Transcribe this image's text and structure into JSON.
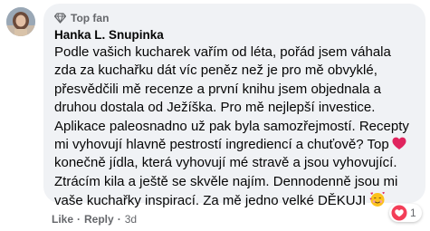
{
  "comment": {
    "badge_icon": "diamond-icon",
    "badge_label": "Top fan",
    "author": "Hanka L. Snupinka",
    "lines": [
      "Podle vašich kucharek vařím od léta, pořád jsem váhala",
      "zda za kuchařku dát víc peněz než je pro mě obvyklé,",
      "přesvědčili mě recenze a první knihu jsem objednala a",
      "druhou dostala od Ježíška. Pro mě nejlepší investice.",
      "Aplikace paleosnadno už pak byla samozřejmostí. Recepty",
      "mi vyhovují hlavně pestrostí ingrediencí a chuťově? Top",
      "konečně jídla, která vyhovují mé stravě a jsou vyhovující.",
      "Ztrácím kila a ještě se skvěle najím. Dennodenně jsou mi",
      "vaše kuchařky inspirací. Za mě jedno velké DĚKUJI"
    ],
    "emojis": [
      "red-heart-icon",
      "smiling-face-with-hearts-icon"
    ]
  },
  "actions": {
    "like_label": "Like",
    "separator": "·",
    "reply_label": "Reply",
    "time": "3d"
  },
  "reaction": {
    "icon": "love-reaction-icon",
    "count": "1"
  },
  "colors": {
    "bubble": "#f0f2f5",
    "text": "#050505",
    "secondary": "#65676b",
    "love": "#f33e58"
  }
}
